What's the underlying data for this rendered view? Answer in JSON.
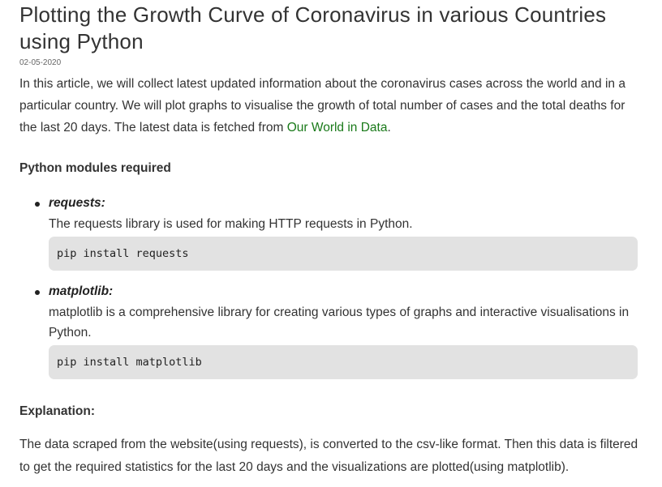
{
  "article": {
    "title": "Plotting the Growth Curve of Coronavirus in various Countries using Python",
    "date": "02-05-2020",
    "intro_text": "In this article, we will collect latest updated information about the coronavirus cases across the world and in a particular country. We will plot graphs to visualise the growth of total number of cases and the total deaths for the last 20 days. The latest data is fetched from ",
    "intro_link": "Our World in Data",
    "intro_end": ".",
    "link_color": "#1a7a1a"
  },
  "modules_section": {
    "heading": "Python modules required",
    "items": [
      {
        "name": "requests:",
        "description": "The requests library is used for making HTTP requests in Python.",
        "code": "pip install requests"
      },
      {
        "name": "matplotlib:",
        "description": "matplotlib is a comprehensive library for creating various types of graphs and interactive visualisations in Python.",
        "code": "pip install matplotlib"
      }
    ]
  },
  "explanation": {
    "heading": "Explanation:",
    "text": "The data scraped from the website(using requests), is converted to the csv-like format. Then this data is filtered to get the required statistics for the last 20 days and the visualizations are plotted(using matplotlib)."
  }
}
